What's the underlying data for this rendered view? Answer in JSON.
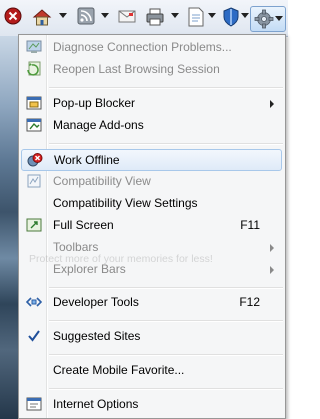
{
  "toolbar": {
    "buttons": [
      {
        "icon": "stop-icon"
      },
      {
        "icon": "home-icon"
      },
      {
        "icon": "feeds-icon"
      },
      {
        "icon": "read-mail-icon"
      },
      {
        "icon": "print-icon"
      },
      {
        "icon": "page-icon"
      },
      {
        "icon": "safety-shield-icon"
      },
      {
        "icon": "tools-gear-icon"
      }
    ]
  },
  "menu": {
    "items": [
      {
        "label": "Diagnose Connection Problems...",
        "disabled": true,
        "icon": "diagnose-connection-icon"
      },
      {
        "label": "Reopen Last Browsing Session",
        "disabled": true,
        "icon": "reopen-session-icon"
      },
      {
        "label": "Pop-up Blocker",
        "submenu": true,
        "icon": "popup-blocker-icon"
      },
      {
        "label": "Manage Add-ons",
        "icon": "manage-addons-icon"
      },
      {
        "label": "Work Offline",
        "highlighted": true,
        "icon": "work-offline-icon"
      },
      {
        "label": "Compatibility View",
        "disabled": true,
        "icon": "compatibility-view-icon"
      },
      {
        "label": "Compatibility View Settings"
      },
      {
        "label": "Full Screen",
        "shortcut": "F11",
        "icon": "full-screen-icon"
      },
      {
        "label": "Toolbars",
        "disabled": true,
        "submenu": true
      },
      {
        "label": "Explorer Bars",
        "disabled": true,
        "submenu": true
      },
      {
        "label": "Developer Tools",
        "shortcut": "F12",
        "icon": "developer-tools-icon"
      },
      {
        "label": "Suggested Sites",
        "checked": true,
        "icon": "checkmark-icon"
      },
      {
        "label": "Create Mobile Favorite..."
      },
      {
        "label": "Internet Options",
        "icon": "internet-options-icon"
      }
    ]
  },
  "watermark": "Protect more of your memories for less!"
}
